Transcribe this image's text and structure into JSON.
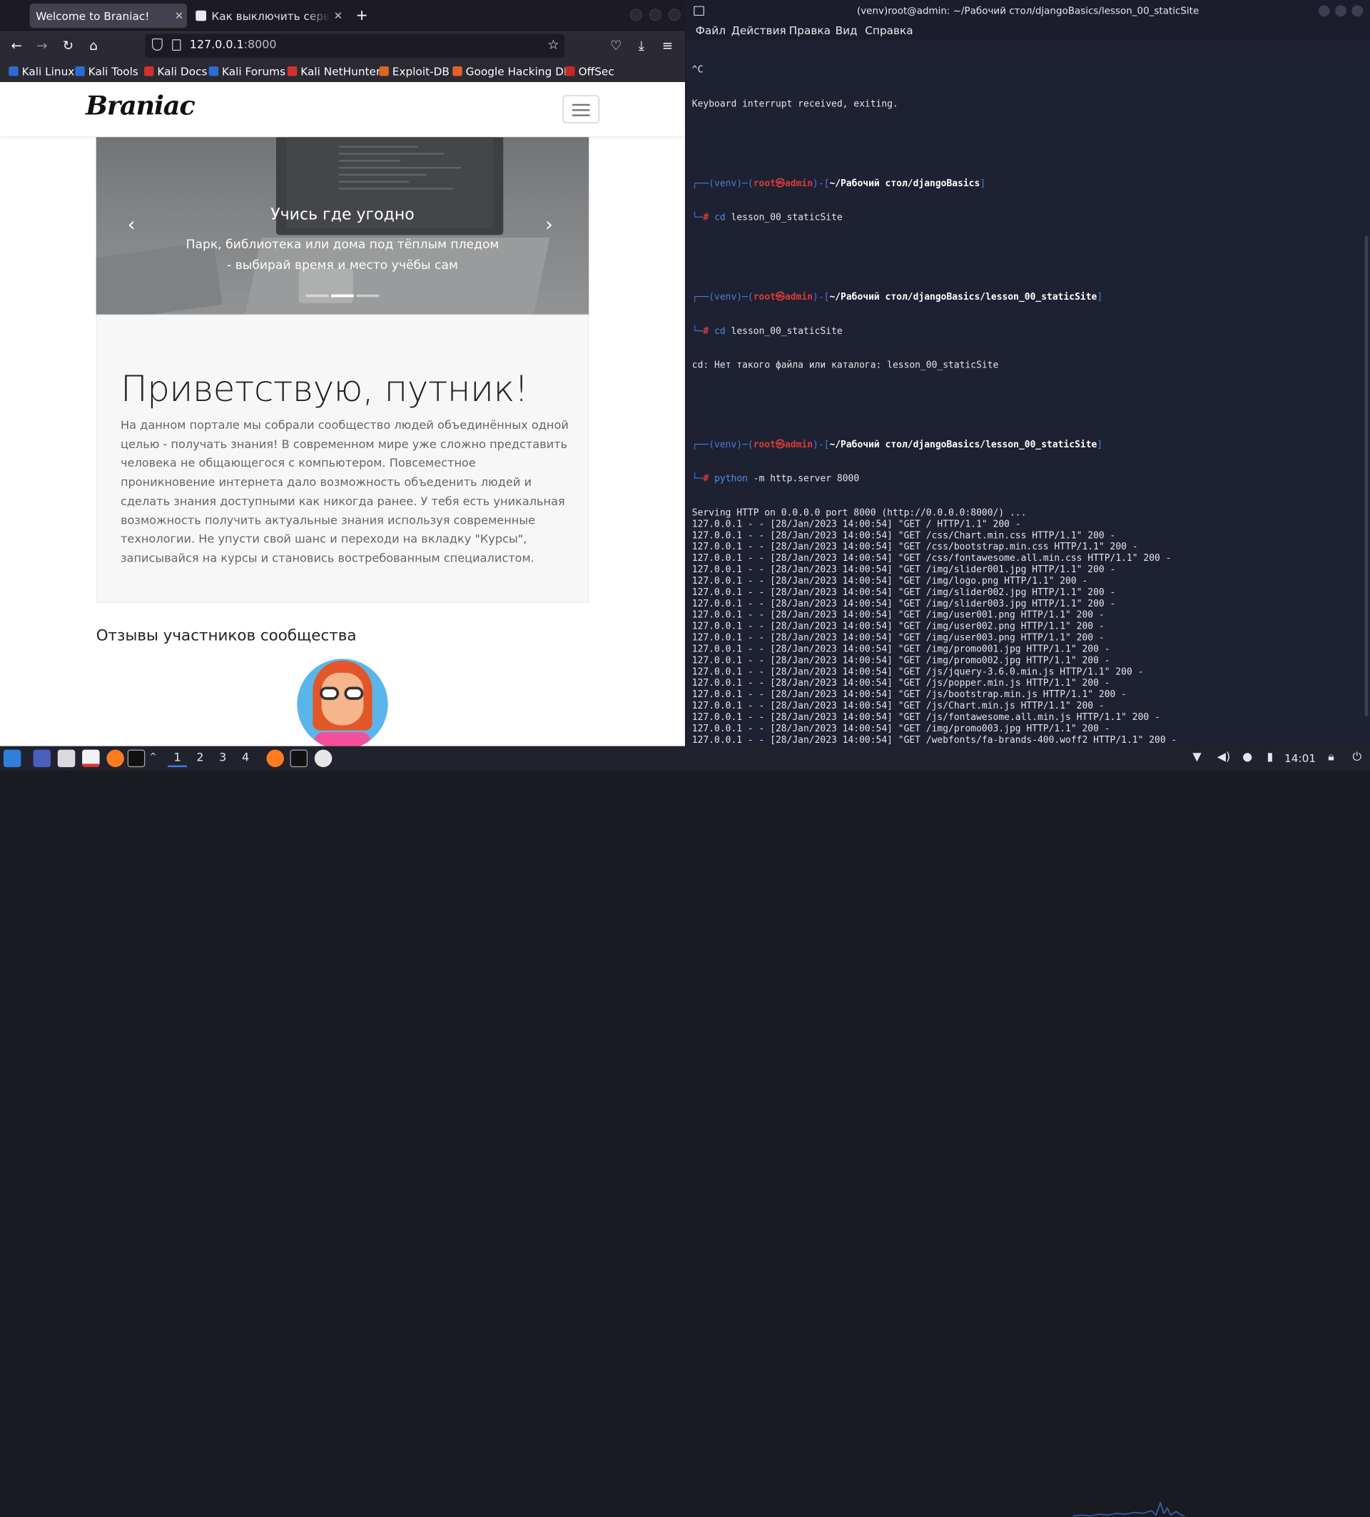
{
  "browser": {
    "tabs": [
      {
        "title": "Welcome to Braniac!",
        "active": true
      },
      {
        "title": "Как выключить сервер d",
        "active": false
      }
    ],
    "new_tab_symbol": "+",
    "url_host": "127.0.0.1",
    "url_port": ":8000",
    "bookmarks": [
      {
        "label": "Kali Linux",
        "color": "#2d6bd1"
      },
      {
        "label": "Kali Tools",
        "color": "#2d6bd1"
      },
      {
        "label": "Kali Docs",
        "color": "#d1322d"
      },
      {
        "label": "Kali Forums",
        "color": "#2d6bd1"
      },
      {
        "label": "Kali NetHunter",
        "color": "#d1322d"
      },
      {
        "label": "Exploit-DB",
        "color": "#e0622a"
      },
      {
        "label": "Google Hacking DB",
        "color": "#e0622a"
      },
      {
        "label": "OffSec",
        "color": "#c62828"
      }
    ]
  },
  "site": {
    "logo": "Braniac",
    "carousel": {
      "title": "Учись где угодно",
      "text": "Парк, библиотека или дома под тёплым пледом - выбирай время и место учёбы сам",
      "prev": "‹",
      "next": "›",
      "active_slide": 2,
      "slide_count": 3
    },
    "greeting": "Приветствую, путник!",
    "intro": "На данном портале мы собрали сообщество людей объединённых одной целью - получать знания! В современном мире уже сложно представить человека не общающегося с компьютером. Повсеместное проникновение интернета дало возможность объеденить людей и сделать знания доступными как никогда ранее. У тебя есть уникальная возможность получить актуальные знания используя современные технологии. Не упусти свой шанс и переходи на вкладку \"Курсы\", записывайся на курсы и становись востребованным специалистом.",
    "reviews_title": "Отзывы участников сообщества"
  },
  "terminal": {
    "title": "(venv)root@admin: ~/Рабочий стол/djangoBasics/lesson_00_staticSite",
    "menu": [
      "Файл",
      "Действия",
      "Правка",
      "Вид",
      "Справка"
    ],
    "pre_lines": [
      "^C",
      "Keyboard interrupt received, exiting."
    ],
    "prompts": [
      {
        "venv": "(venv)",
        "user": "root㉿admin",
        "path": "~/Рабочий стол/djangoBasics",
        "cmd_kw": "cd",
        "cmd_rest": " lesson_00_staticSite",
        "output": []
      },
      {
        "venv": "(venv)",
        "user": "root㉿admin",
        "path": "~/Рабочий стол/djangoBasics/lesson_00_staticSite",
        "cmd_kw": "cd",
        "cmd_rest": " lesson_00_staticSite",
        "output": [
          "cd: Нет такого файла или каталога: lesson_00_staticSite"
        ]
      },
      {
        "venv": "(venv)",
        "user": "root㉿admin",
        "path": "~/Рабочий стол/djangoBasics/lesson_00_staticSite",
        "cmd_kw": "python",
        "cmd_rest": " -m http.server 8000",
        "output": [
          "Serving HTTP on 0.0.0.0 port 8000 (http://0.0.0.0:8000/) ...",
          "127.0.0.1 - - [28/Jan/2023 14:00:54] \"GET / HTTP/1.1\" 200 -",
          "127.0.0.1 - - [28/Jan/2023 14:00:54] \"GET /css/Chart.min.css HTTP/1.1\" 200 -",
          "127.0.0.1 - - [28/Jan/2023 14:00:54] \"GET /css/bootstrap.min.css HTTP/1.1\" 200 -",
          "127.0.0.1 - - [28/Jan/2023 14:00:54] \"GET /css/fontawesome.all.min.css HTTP/1.1\" 200 -",
          "127.0.0.1 - - [28/Jan/2023 14:00:54] \"GET /img/slider001.jpg HTTP/1.1\" 200 -",
          "127.0.0.1 - - [28/Jan/2023 14:00:54] \"GET /img/logo.png HTTP/1.1\" 200 -",
          "127.0.0.1 - - [28/Jan/2023 14:00:54] \"GET /img/slider002.jpg HTTP/1.1\" 200 -",
          "127.0.0.1 - - [28/Jan/2023 14:00:54] \"GET /img/slider003.jpg HTTP/1.1\" 200 -",
          "127.0.0.1 - - [28/Jan/2023 14:00:54] \"GET /img/user001.png HTTP/1.1\" 200 -",
          "127.0.0.1 - - [28/Jan/2023 14:00:54] \"GET /img/user002.png HTTP/1.1\" 200 -",
          "127.0.0.1 - - [28/Jan/2023 14:00:54] \"GET /img/user003.png HTTP/1.1\" 200 -",
          "127.0.0.1 - - [28/Jan/2023 14:00:54] \"GET /img/promo001.jpg HTTP/1.1\" 200 -",
          "127.0.0.1 - - [28/Jan/2023 14:00:54] \"GET /img/promo002.jpg HTTP/1.1\" 200 -",
          "127.0.0.1 - - [28/Jan/2023 14:00:54] \"GET /js/jquery-3.6.0.min.js HTTP/1.1\" 200 -",
          "127.0.0.1 - - [28/Jan/2023 14:00:54] \"GET /js/popper.min.js HTTP/1.1\" 200 -",
          "127.0.0.1 - - [28/Jan/2023 14:00:54] \"GET /js/bootstrap.min.js HTTP/1.1\" 200 -",
          "127.0.0.1 - - [28/Jan/2023 14:00:54] \"GET /js/Chart.min.js HTTP/1.1\" 200 -",
          "127.0.0.1 - - [28/Jan/2023 14:00:54] \"GET /js/fontawesome.all.min.js HTTP/1.1\" 200 -",
          "127.0.0.1 - - [28/Jan/2023 14:00:54] \"GET /img/promo003.jpg HTTP/1.1\" 200 -",
          "127.0.0.1 - - [28/Jan/2023 14:00:54] \"GET /webfonts/fa-brands-400.woff2 HTTP/1.1\" 200 -"
        ]
      }
    ]
  },
  "taskbar": {
    "workspaces": [
      "1",
      "2",
      "3",
      "4"
    ],
    "active_workspace": "1",
    "clock": "14:01",
    "colors": {
      "accent": "#3b7fe0"
    }
  }
}
